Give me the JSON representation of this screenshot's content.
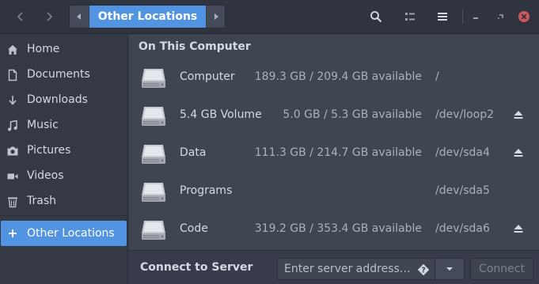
{
  "header": {
    "path_current": "Other Locations"
  },
  "sidebar": {
    "items": [
      {
        "label": "Home",
        "icon": "home-icon"
      },
      {
        "label": "Documents",
        "icon": "document-icon"
      },
      {
        "label": "Downloads",
        "icon": "download-icon"
      },
      {
        "label": "Music",
        "icon": "music-icon"
      },
      {
        "label": "Pictures",
        "icon": "camera-icon"
      },
      {
        "label": "Videos",
        "icon": "video-icon"
      },
      {
        "label": "Trash",
        "icon": "trash-icon"
      }
    ],
    "active": {
      "label": "Other Locations",
      "icon": "plus-icon"
    }
  },
  "main": {
    "section_title": "On This Computer",
    "volumes": [
      {
        "name": "Computer",
        "size": "189.3 GB / 209.4 GB available",
        "path": "/",
        "eject": false
      },
      {
        "name": "5.4 GB Volume",
        "size": "5.0 GB / 5.3 GB available",
        "path": "/dev/loop2",
        "eject": true
      },
      {
        "name": "Data",
        "size": "111.3 GB / 214.7 GB available",
        "path": "/dev/sda4",
        "eject": true
      },
      {
        "name": "Programs",
        "size": "",
        "path": "/dev/sda5",
        "eject": false
      },
      {
        "name": "Code",
        "size": "319.2 GB / 353.4 GB available",
        "path": "/dev/sda6",
        "eject": true
      }
    ]
  },
  "connect": {
    "label": "Connect to Server",
    "placeholder": "Enter server address…",
    "button": "Connect"
  },
  "colors": {
    "accent": "#5294e2",
    "close": "#cc575d"
  }
}
